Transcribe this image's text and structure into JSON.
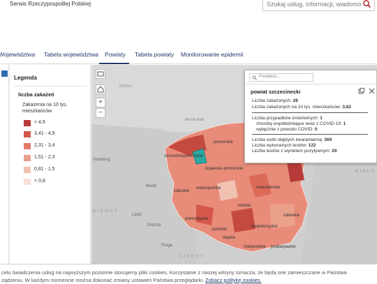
{
  "header": {
    "service_name": "Serwis Rzeczypospolitej Polskiej",
    "search_placeholder": "Szukaj usług, informacji, wiadomości"
  },
  "tabs": [
    {
      "label": "Województwa"
    },
    {
      "label": "Tabela województwa"
    },
    {
      "label": "Powiaty",
      "active": true
    },
    {
      "label": "Tabela powiaty"
    },
    {
      "label": "Monitorowanie epidemii"
    }
  ],
  "legend": {
    "title": "Legenda",
    "subtitle": "liczba zakażeń",
    "description": "Zakażenia na 10 tys. mieszkańców",
    "items": [
      {
        "label": "> 4,9",
        "color": "#b73a3a"
      },
      {
        "label": "3,41 - 4,9",
        "color": "#d4574a"
      },
      {
        "label": "2,31 - 3,4",
        "color": "#e37a68"
      },
      {
        "label": "1,51 - 2,3",
        "color": "#eba08c"
      },
      {
        "label": "0,81 - 1,5",
        "color": "#f1c1b1"
      },
      {
        "label": "< 0,8",
        "color": "#f7e1d6"
      }
    ]
  },
  "map": {
    "labels": {
      "baltic": "Morze Bałtyckie",
      "sea_short": "Morze Bałt.",
      "hamburg": "Hamburg",
      "berlin": "Berlin",
      "lipsk": "Lipsk",
      "drezno": "Drezno",
      "praga": "Praga",
      "niemcy": "NIEMCY",
      "czechy": "CZECHY",
      "bialoruś": "BIAŁO",
      "kalin": "Kalin",
      "wilno": "Wilno",
      "szwecja": "Malmo"
    },
    "voivodeships": [
      {
        "name": "pomorskie"
      },
      {
        "name": "zachodniopomorskie"
      },
      {
        "name": "kujawsko-pomorskie"
      },
      {
        "name": "lubuskie"
      },
      {
        "name": "wielkopolskie"
      },
      {
        "name": "mazowieckie"
      },
      {
        "name": "łódzkie"
      },
      {
        "name": "lubelskie"
      },
      {
        "name": "dolnośląskie"
      },
      {
        "name": "opolskie"
      },
      {
        "name": "świętokrzyskie"
      },
      {
        "name": "śląskie"
      },
      {
        "name": "podkarpackie"
      },
      {
        "name": "małopolskie"
      }
    ],
    "controls": {
      "zoom_in": "+",
      "zoom_out": "−"
    }
  },
  "popup": {
    "search_placeholder": "Powiększ...",
    "title": "powiat szczecinecki",
    "lines_group1": [
      {
        "label": "Liczba zakażonych:",
        "value": "28"
      },
      {
        "label": "Liczba zakażonych na 10 tys. mieszkańców:",
        "value": "3,62"
      }
    ],
    "lines_group2": [
      {
        "label": "Liczba przypadków śmiertelnych:",
        "value": "1"
      },
      {
        "label": "   choroby współistniejące wraz z COVID-19:",
        "value": "1"
      },
      {
        "label": "   wyłącznie z powodu COVID:",
        "value": "0"
      }
    ],
    "lines_group3": [
      {
        "label": "Liczba osób objętych kwarantanną:",
        "value": "369"
      },
      {
        "label": "Liczba wykonanych testów:",
        "value": "122"
      },
      {
        "label": "Liczba testów z wynikiem pozytywnym:",
        "value": "29"
      }
    ]
  },
  "cookie": {
    "line1": "celu świadczenia usług na najwyższym poziomie stosujemy pliki cookies. Korzystanie z naszej witryny oznacza, że będą one zamieszczane w Państwa",
    "line2": "ządzeniu. W każdym momencie można dokonać zmiany ustawień Państwa przeglądarki.",
    "link": "Zobacz politykę cookies."
  }
}
